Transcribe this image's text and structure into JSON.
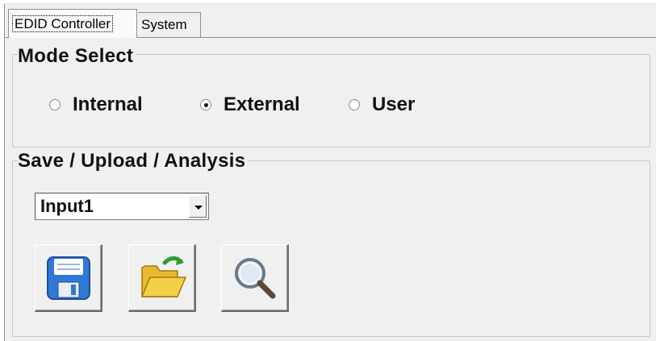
{
  "tabs": [
    {
      "label": "EDID Controller",
      "active": true
    },
    {
      "label": "System",
      "active": false
    }
  ],
  "mode_select": {
    "title": "Mode Select",
    "options": [
      {
        "label": "Internal",
        "checked": false
      },
      {
        "label": "External",
        "checked": true
      },
      {
        "label": "User",
        "checked": false
      }
    ]
  },
  "save_upload": {
    "title": "Save / Upload / Analysis",
    "input_selected": "Input1",
    "buttons": [
      {
        "icon": "floppy-disk-icon",
        "action": "save"
      },
      {
        "icon": "open-folder-icon",
        "action": "upload"
      },
      {
        "icon": "magnifier-icon",
        "action": "analysis"
      }
    ]
  },
  "colors": {
    "window_bg": "#f0f0f0",
    "group_border": "#c8c8c8",
    "floppy_blue": "#2f78d6",
    "folder_yellow": "#f4cf4a",
    "arrow_green": "#2f9b2f"
  }
}
